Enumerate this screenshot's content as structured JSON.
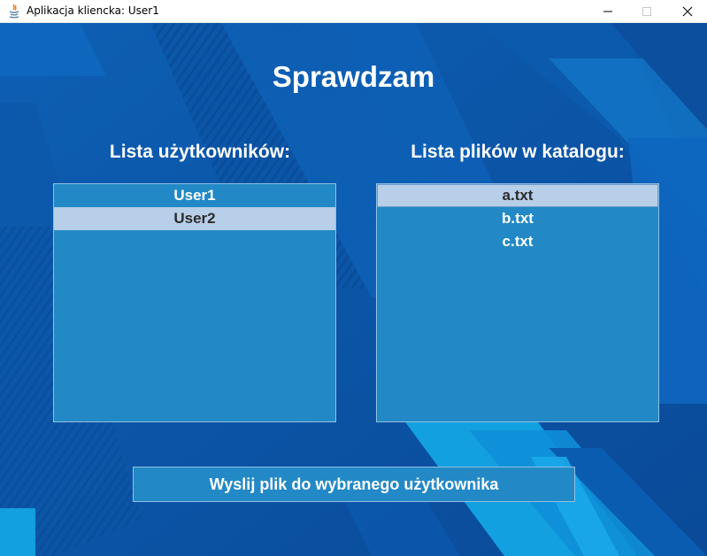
{
  "window": {
    "title": "Aplikacja kliencka: User1",
    "minimize_symbol": "—",
    "maximize_symbol": "☐",
    "close_symbol": "✕"
  },
  "main": {
    "title": "Sprawdzam",
    "users_label": "Lista użytkowników:",
    "files_label": "Lista plików w katalogu:",
    "users": [
      {
        "name": "User1",
        "selected": false
      },
      {
        "name": "User2",
        "selected": true
      }
    ],
    "files": [
      {
        "name": "a.txt",
        "selected": true
      },
      {
        "name": "b.txt",
        "selected": false
      },
      {
        "name": "c.txt",
        "selected": false
      }
    ],
    "send_button_label": "Wyslij plik do wybranego użytkownika"
  },
  "colors": {
    "background": "#0a4fa0",
    "list_background": "#2389c6",
    "selection": "#b8cfe9",
    "text": "#ffffff"
  },
  "icons": {
    "app": "java-icon"
  }
}
